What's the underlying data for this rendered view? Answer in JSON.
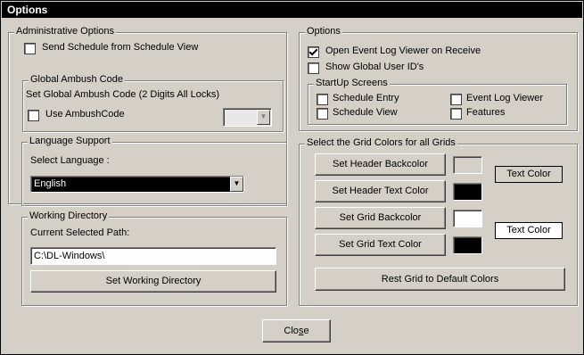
{
  "window": {
    "title": "Options"
  },
  "admin": {
    "legend": "Administrative Options",
    "send_schedule_label": "Send Schedule from Schedule View",
    "send_schedule_checked": false,
    "ambush": {
      "legend": "Global Ambush Code",
      "description": "Set Global Ambush Code (2 Digits All Locks)",
      "use_label": "Use AmbushCode",
      "use_checked": false,
      "code_value": ""
    }
  },
  "language": {
    "legend": "Language Support",
    "select_label": "Select Language :",
    "selected": "English"
  },
  "working_dir": {
    "legend": "Working Directory",
    "path_label": "Current Selected Path:",
    "path_value": "C:\\DL-Windows\\",
    "set_button": "Set Working Directory"
  },
  "options": {
    "legend": "Options",
    "open_event_log_label": "Open Event Log Viewer on Receive",
    "open_event_log_checked": true,
    "show_user_ids_label": "Show Global User ID's",
    "show_user_ids_checked": false,
    "startup": {
      "legend": "StartUp Screens",
      "schedule_entry": "Schedule Entry",
      "schedule_view": "Schedule View",
      "event_log_viewer": "Event Log Viewer",
      "features": "Features"
    }
  },
  "grid_colors": {
    "legend": "Select the Grid Colors for all Grids",
    "header_backcolor_button": "Set Header Backcolor",
    "header_text_button": "Set Header Text Color",
    "grid_backcolor_button": "Set Grid Backcolor",
    "grid_text_button": "Set Grid Text Color",
    "header_preview_text": "Text Color",
    "grid_preview_text": "Text Color",
    "reset_button": "Rest Grid to Default Colors",
    "header_backcolor": "#d4d0c8",
    "header_textcolor": "#000000",
    "grid_backcolor": "#ffffff",
    "grid_textcolor": "#000000"
  },
  "close_button": {
    "prefix": "Clo",
    "accel": "s",
    "suffix": "e"
  },
  "colors": {
    "face": "#d4d0c8",
    "titlebar": "#000000",
    "language_select_bg": "#000000"
  }
}
